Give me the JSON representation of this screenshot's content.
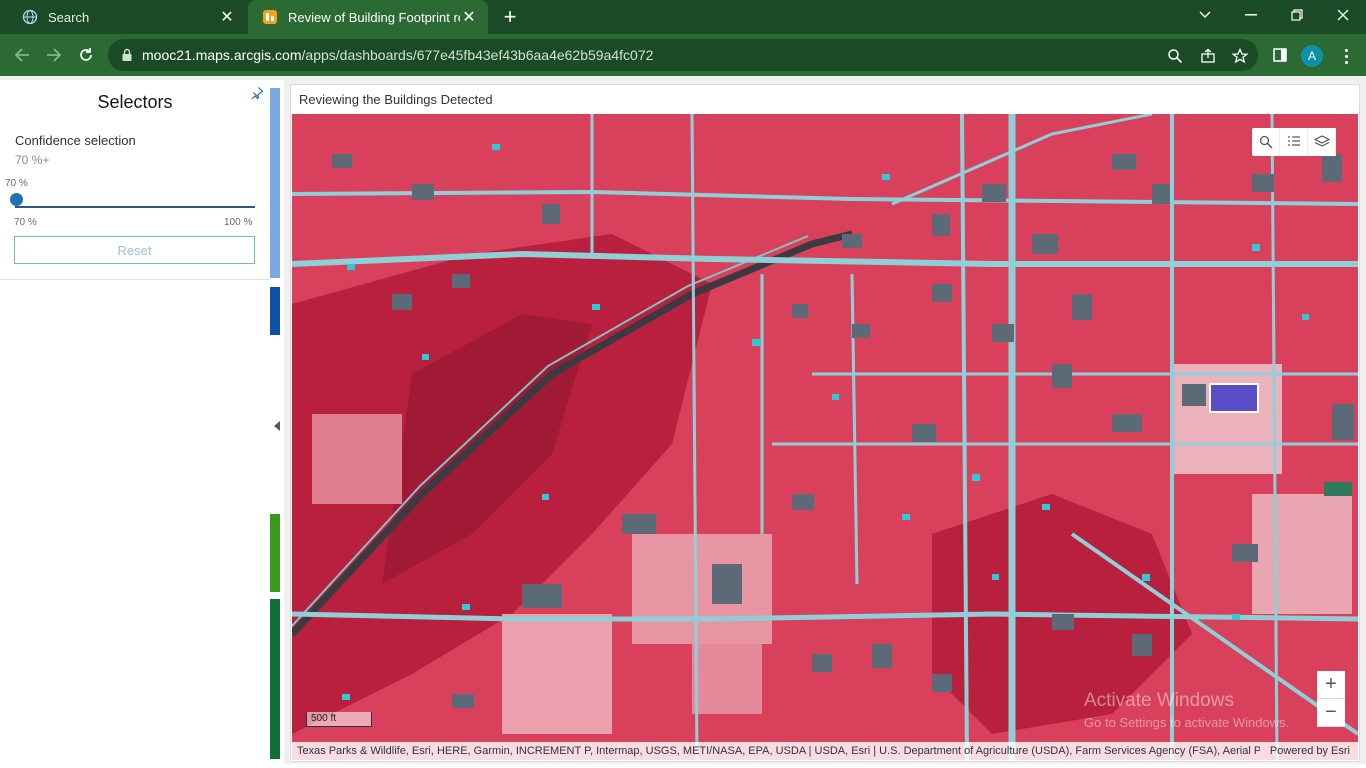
{
  "browser": {
    "tabs": [
      {
        "title": "Search",
        "active": false
      },
      {
        "title": "Review of Building Footprint res",
        "active": true
      }
    ],
    "url_host": "mooc21.maps.arcgis.com",
    "url_path": "/apps/dashboards/677e45fb43ef43b6aa4e62b59a4fc072",
    "profile_initial": "A",
    "icons": [
      "back-arrow-icon",
      "forward-arrow-icon",
      "reload-icon",
      "lock-icon",
      "zoom-icon",
      "share-icon",
      "star-icon",
      "sidepanel-icon",
      "menu-icon"
    ]
  },
  "selectors": {
    "title": "Selectors",
    "confidence_label": "Confidence selection",
    "confidence_value": "70 %+",
    "slider_tooltip": "70 %",
    "slider_min_label": "70 %",
    "slider_max_label": "100 %",
    "slider_value_fraction": 0,
    "reset_label": "Reset"
  },
  "map_panel": {
    "title": "Reviewing the Buildings Detected",
    "scale_label": "500 ft",
    "attribution": "Texas Parks & Wildlife, Esri, HERE, Garmin, INCREMENT P, Intermap, USGS, METI/NASA, EPA, USDA | USDA, Esri | U.S. Department of Agriculture (USDA), Farm Services Agency (FSA), Aerial Photogra...",
    "powered_by": "Powered by Esri",
    "watermark_line1": "Activate Windows",
    "watermark_line2": "Go to Settings to activate Windows.",
    "zoom_in": "+",
    "zoom_out": "−"
  },
  "colors": {
    "chrome_dark": "#1b4a27",
    "chrome_mid": "#2b6a32",
    "accent_blue": "#1f70b5",
    "imagery_red": "#d8405c",
    "road_cyan": "#8fd0d8"
  }
}
